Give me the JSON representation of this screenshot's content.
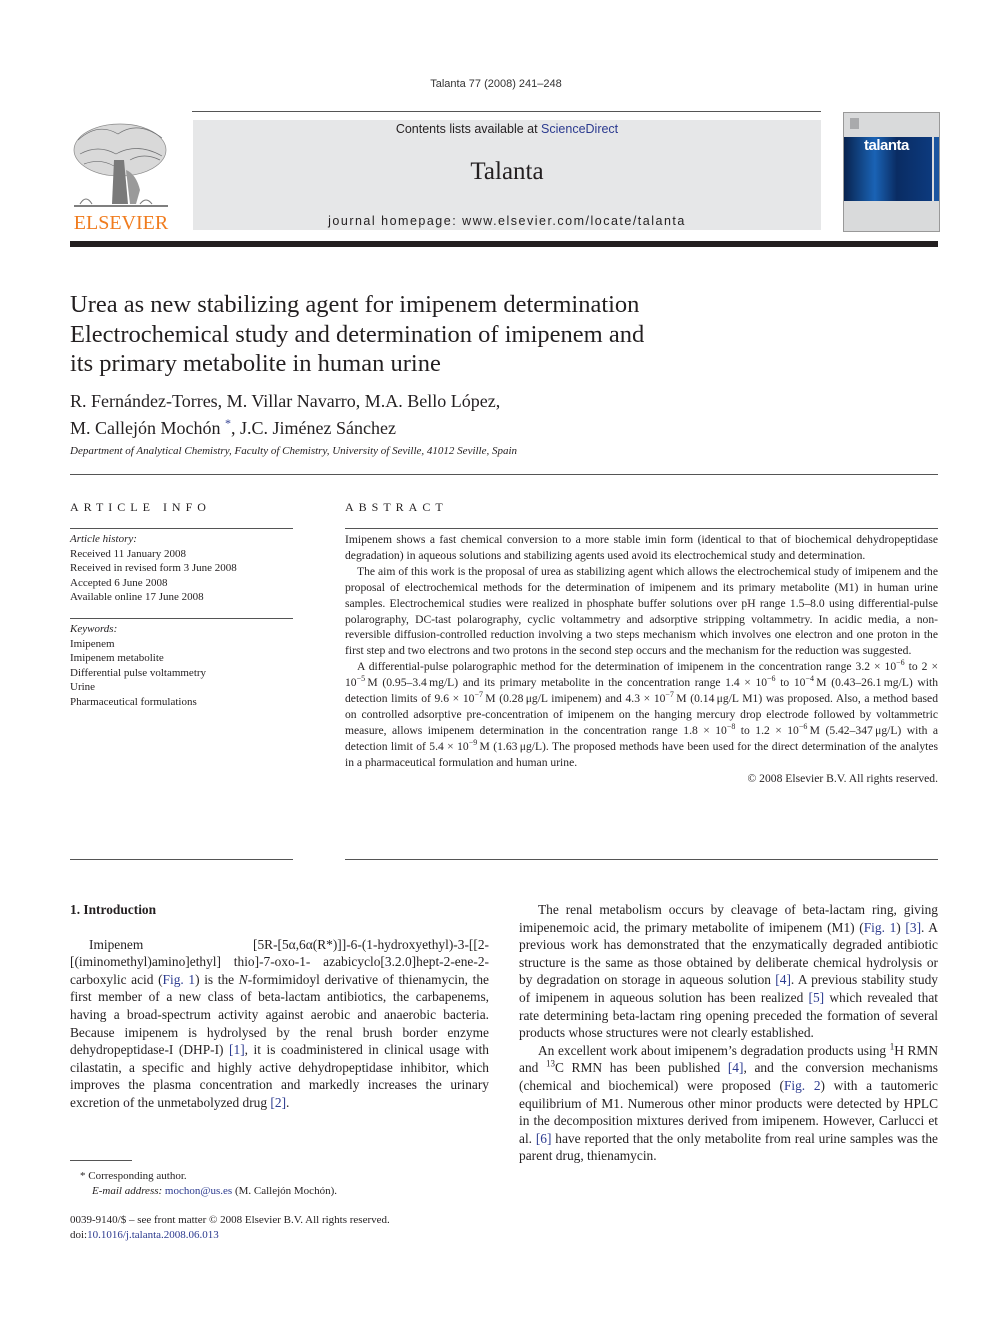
{
  "header": {
    "running_head": "Talanta 77 (2008) 241–248",
    "contents_prefix": "Contents lists available at ",
    "contents_link": "ScienceDirect",
    "journal_name": "Talanta",
    "homepage_prefix": "journal homepage: ",
    "homepage_url": "www.elsevier.com/locate/talanta",
    "publisher_logo_text": "ELSEVIER",
    "cover_title": "talanta",
    "publisher_color": "#f07c1e",
    "link_color": "#2b3a8f"
  },
  "article": {
    "title_lines": [
      "Urea as new stabilizing agent for imipenem determination",
      "Electrochemical study and determination of imipenem and",
      "its primary metabolite in human urine"
    ],
    "authors_line1": "R. Fernández-Torres, M. Villar Navarro, M.A. Bello López,",
    "authors_line2_a": "M. Callejón Mochón",
    "corresponding_mark": "*",
    "authors_line2_b": ", J.C. Jiménez Sánchez",
    "affiliation": "Department of Analytical Chemistry, Faculty of Chemistry, University of Seville, 41012 Seville, Spain"
  },
  "article_info": {
    "caption": "ARTICLE INFO",
    "history_heading": "Article history:",
    "history": [
      "Received 11 January 2008",
      "Received in revised form 3 June 2008",
      "Accepted 6 June 2008",
      "Available online 17 June 2008"
    ],
    "keywords_heading": "Keywords:",
    "keywords": [
      "Imipenem",
      "Imipenem metabolite",
      "Differential pulse voltammetry",
      "Urine",
      "Pharmaceutical formulations"
    ]
  },
  "abstract": {
    "caption": "ABSTRACT",
    "p1": "Imipenem shows a fast chemical conversion to a more stable imin form (identical to that of biochemical dehydropeptidase degradation) in aqueous solutions and stabilizing agents used avoid its electrochemical study and determination.",
    "p2": "The aim of this work is the proposal of urea as stabilizing agent which allows the electrochemical study of imipenem and the proposal of electrochemical methods for the determination of imipenem and its primary metabolite (M1) in human urine samples. Electrochemical studies were realized in phosphate buffer solutions over pH range 1.5–8.0 using differential-pulse polarography, DC-tast polarography, cyclic voltammetry and adsorptive stripping voltammetry. In acidic media, a non-reversible diffusion-controlled reduction involving a two steps mechanism which involves one electron and one proton in the first step and two electrons and two protons in the second step occurs and the mechanism for the reduction was suggested.",
    "p3": [
      "A differential-pulse polarographic method for the determination of imipenem in the concentration range 3.2 × 10",
      "−6",
      " to 2 × 10",
      "−5",
      " M (0.95–3.4 mg/L) and its primary metabolite in the concentration range 1.4 × 10",
      "−6",
      " to 10",
      "−4",
      " M (0.43–26.1 mg/L) with detection limits of 9.6 × 10",
      "−7",
      " M (0.28 μg/L imipenem) and 4.3 × 10",
      "−7",
      " M (0.14 μg/L M1) was proposed. Also, a method based on controlled adsorptive pre-concentration of imipenem on the hanging mercury drop electrode followed by voltammetric measure, allows imipenem determination in the concentration range 1.8 × 10",
      "−8",
      " to 1.2 × 10",
      "−6",
      " M (5.42–347 μg/L) with a detection limit of 5.4 × 10",
      "−9",
      " M (1.63 μg/L). The proposed methods have been used for the direct determination of the analytes in a pharmaceutical formulation and human urine."
    ],
    "copyright": "© 2008 Elsevier B.V. All rights reserved."
  },
  "body": {
    "section_heading": "1.  Introduction",
    "left_p1": [
      "Imipenem [5R-[5α,6α(R*)]]-6-(1-hydroxyethyl)-3-[[2-[(iminomethyl)amino]ethyl] thio]-7-oxo-1- azabicyclo[3.2.0]hept-2-ene-2-carboxylic acid (",
      "Fig. 1",
      ") is the ",
      "N",
      "-formimidoyl derivative of thienamycin, the first member of a new class of beta-lactam antibiotics, the carbapenems, having a broad-spectrum activity against aerobic and anaerobic bacteria. Because imipenem is hydrolysed by the renal brush border enzyme dehydropeptidase-I (DHP-I) ",
      "[1]",
      ", it is coadministered in clinical usage with cilastatin, a specific and highly active dehydropeptidase inhibitor, which improves the plasma concentration and markedly increases the urinary excretion of the unmetabolyzed drug ",
      "[2]",
      "."
    ],
    "right_p1": [
      "The renal metabolism occurs by cleavage of beta-lactam ring, giving imipenemoic acid, the primary metabolite of imipenem (M1) (",
      "Fig. 1",
      ") ",
      "[3]",
      ". A previous work has demonstrated that the enzymatically degraded antibiotic structure is the same as those obtained by deliberate chemical hydrolysis or by degradation on storage in aqueous solution ",
      "[4]",
      ". A previous stability study of imipenem in aqueous solution has been realized ",
      "[5]",
      " which revealed that rate determining beta-lactam ring opening preceded the formation of several products whose structures were not clearly established."
    ],
    "right_p2": [
      "An excellent work about imipenem’s degradation products using ",
      "1",
      "H RMN and ",
      "13",
      "C RMN has been published ",
      "[4]",
      ", and the conversion mechanisms (chemical and biochemical) were proposed (",
      "Fig. 2",
      ") with a tautomeric equilibrium of M1. Numerous other minor products were detected by HPLC in the decomposition mixtures derived from imipenem. However, Carlucci et al. ",
      "[6]",
      " have reported that the only metabolite from real urine samples was the parent drug, thienamycin."
    ]
  },
  "footnotes": {
    "corresponding": "* Corresponding author.",
    "email_label": "E-mail address:",
    "email": "mochon@us.es",
    "email_suffix": " (M. Callejón Mochón).",
    "front_matter": "0039-9140/$ – see front matter © 2008 Elsevier B.V. All rights reserved.",
    "doi_prefix": "doi:",
    "doi": "10.1016/j.talanta.2008.06.013"
  }
}
